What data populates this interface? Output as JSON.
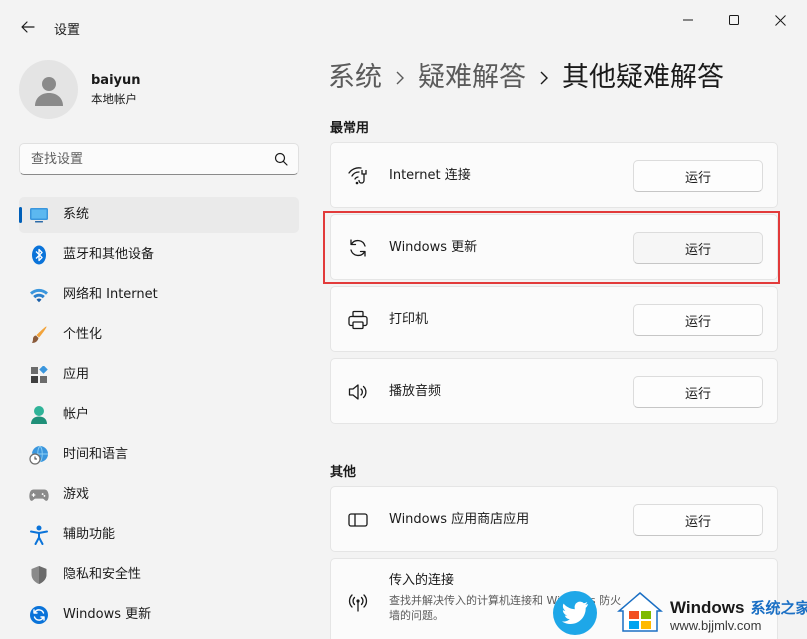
{
  "window": {
    "title": "设置",
    "minimize_icon": "minimize-icon",
    "maximize_icon": "maximize-icon",
    "close_icon": "close-icon"
  },
  "user": {
    "name": "baiyun",
    "account_type": "本地帐户"
  },
  "search": {
    "placeholder": "查找设置"
  },
  "sidebar": {
    "items": [
      {
        "label": "系统",
        "icon": "system-icon",
        "active": true
      },
      {
        "label": "蓝牙和其他设备",
        "icon": "bluetooth-icon"
      },
      {
        "label": "网络和 Internet",
        "icon": "wifi-icon"
      },
      {
        "label": "个性化",
        "icon": "brush-icon"
      },
      {
        "label": "应用",
        "icon": "apps-icon"
      },
      {
        "label": "帐户",
        "icon": "account-icon"
      },
      {
        "label": "时间和语言",
        "icon": "globe-clock-icon"
      },
      {
        "label": "游戏",
        "icon": "gamepad-icon"
      },
      {
        "label": "辅助功能",
        "icon": "accessibility-icon"
      },
      {
        "label": "隐私和安全性",
        "icon": "shield-icon"
      },
      {
        "label": "Windows 更新",
        "icon": "update-icon"
      }
    ]
  },
  "breadcrumb": {
    "items": [
      "系统",
      "疑难解答",
      "其他疑难解答"
    ]
  },
  "sections": {
    "common": {
      "title": "最常用",
      "items": [
        {
          "label": "Internet 连接",
          "icon": "internet-icon",
          "button": "运行"
        },
        {
          "label": "Windows 更新",
          "icon": "refresh-icon",
          "button": "运行"
        },
        {
          "label": "打印机",
          "icon": "printer-icon",
          "button": "运行"
        },
        {
          "label": "播放音频",
          "icon": "speaker-icon",
          "button": "运行"
        }
      ]
    },
    "other": {
      "title": "其他",
      "items": [
        {
          "label": "Windows 应用商店应用",
          "icon": "store-app-icon",
          "button": "运行"
        },
        {
          "label": "传入的连接",
          "description": "查找并解决传入的计算机连接和 Windows 防火墙的问题。",
          "icon": "antenna-icon"
        }
      ]
    }
  },
  "watermark": {
    "brand": "Windows",
    "brand_suffix": "系统之家",
    "url": "www.bjjmlv.com"
  },
  "colors": {
    "accent": "#005fb8",
    "highlight_border": "#e23a3a",
    "background": "#f3f3f3",
    "card": "#fbfbfb"
  }
}
